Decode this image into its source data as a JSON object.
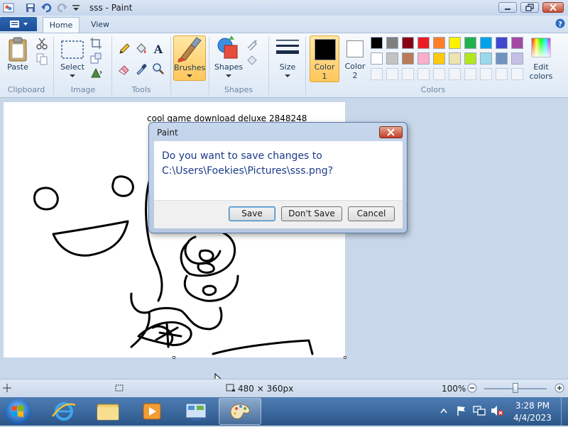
{
  "window": {
    "title": "sss - Paint"
  },
  "ribbon": {
    "tabs": [
      "Home",
      "View"
    ],
    "clipboard": {
      "paste_label": "Paste",
      "group_label": "Clipboard"
    },
    "image": {
      "select_label": "Select",
      "group_label": "Image"
    },
    "tools": {
      "group_label": "Tools"
    },
    "brushes": {
      "label": "Brushes"
    },
    "shapes": {
      "label": "Shapes",
      "group_label": "Shapes"
    },
    "size": {
      "label": "Size"
    },
    "color1": {
      "label_line1": "Color",
      "label_line2": "1",
      "value": "#000000"
    },
    "color2": {
      "label_line1": "Color",
      "label_line2": "2",
      "value": "#ffffff"
    },
    "colors": {
      "group_label": "Colors",
      "edit_label_line1": "Edit",
      "edit_label_line2": "colors",
      "palette_row1": [
        "#000000",
        "#7f7f7f",
        "#880015",
        "#ed1c24",
        "#ff7f27",
        "#fff200",
        "#22b14c",
        "#00a2e8",
        "#3f48cc",
        "#a349a4"
      ],
      "palette_row2": [
        "#ffffff",
        "#c3c3c3",
        "#b97a57",
        "#ffaec9",
        "#ffc90e",
        "#efe4b0",
        "#b5e61d",
        "#99d9ea",
        "#7092be",
        "#c8bfe7"
      ]
    }
  },
  "canvas": {
    "text": "cool game download deluxe 2848248"
  },
  "dialog": {
    "title": "Paint",
    "message_line1": "Do you want to save changes to",
    "message_line2": "C:\\Users\\Foekies\\Pictures\\sss.png?",
    "buttons": {
      "save": "Save",
      "dont_save": "Don't Save",
      "cancel": "Cancel"
    }
  },
  "statusbar": {
    "canvas_size": "480 × 360px",
    "zoom": "100%"
  },
  "taskbar": {
    "time": "3:28 PM",
    "date": "4/4/2023"
  }
}
